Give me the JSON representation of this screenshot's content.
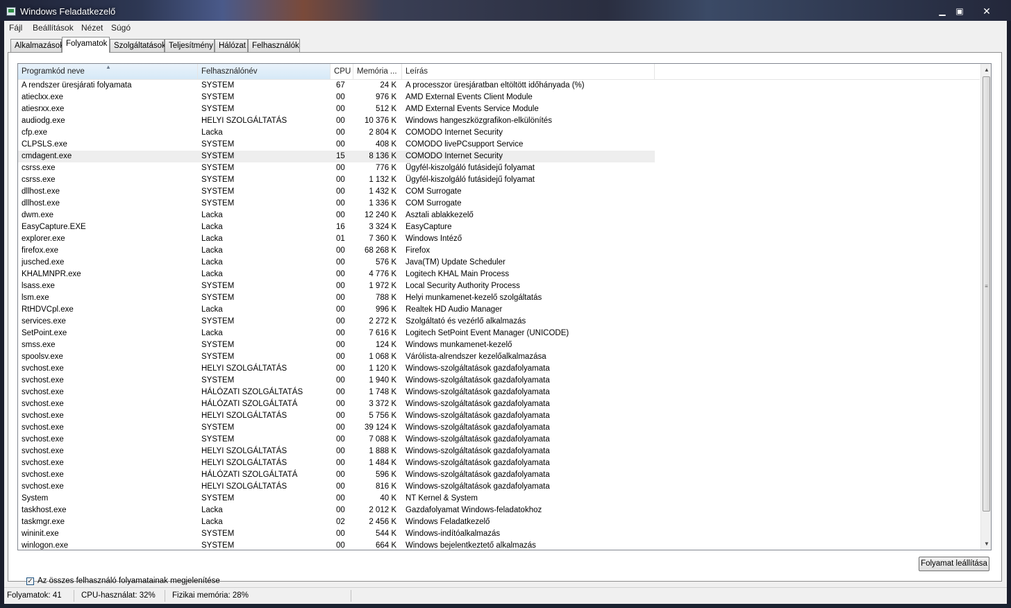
{
  "window": {
    "title": "Windows Feladatkezelő"
  },
  "menu": [
    "Fájl",
    "Beállítások",
    "Nézet",
    "Súgó"
  ],
  "tabs": [
    "Alkalmazások",
    "Folyamatok",
    "Szolgáltatások",
    "Teljesítmény",
    "Hálózat",
    "Felhasználók"
  ],
  "active_tab": "Folyamatok",
  "columns": [
    "Programkód neve",
    "Felhasználónév",
    "CPU",
    "Memória ...",
    "Leírás"
  ],
  "rows": [
    [
      "A rendszer üresjárati folyamata",
      "SYSTEM",
      "67",
      "24 K",
      "A processzor üresjáratban eltöltött időhányada (%)"
    ],
    [
      "atieclxx.exe",
      "SYSTEM",
      "00",
      "976 K",
      "AMD External Events Client Module"
    ],
    [
      "atiesrxx.exe",
      "SYSTEM",
      "00",
      "512 K",
      "AMD External Events Service Module"
    ],
    [
      "audiodg.exe",
      "HELYI SZOLGÁLTATÁS",
      "00",
      "10 376 K",
      "Windows hangeszközgrafikon-elkülönítés"
    ],
    [
      "cfp.exe",
      "Lacka",
      "00",
      "2 804 K",
      "COMODO Internet Security"
    ],
    [
      "CLPSLS.exe",
      "SYSTEM",
      "00",
      "408 K",
      "COMODO livePCsupport Service"
    ],
    [
      "cmdagent.exe",
      "SYSTEM",
      "15",
      "8 136 K",
      "COMODO Internet Security"
    ],
    [
      "csrss.exe",
      "SYSTEM",
      "00",
      "776 K",
      "Ügyfél-kiszolgáló futásidejű folyamat"
    ],
    [
      "csrss.exe",
      "SYSTEM",
      "00",
      "1 132 K",
      "Ügyfél-kiszolgáló futásidejű folyamat"
    ],
    [
      "dllhost.exe",
      "SYSTEM",
      "00",
      "1 432 K",
      "COM Surrogate"
    ],
    [
      "dllhost.exe",
      "SYSTEM",
      "00",
      "1 336 K",
      "COM Surrogate"
    ],
    [
      "dwm.exe",
      "Lacka",
      "00",
      "12 240 K",
      "Asztali ablakkezelő"
    ],
    [
      "EasyCapture.EXE",
      "Lacka",
      "16",
      "3 324 K",
      "EasyCapture"
    ],
    [
      "explorer.exe",
      "Lacka",
      "01",
      "7 360 K",
      "Windows Intéző"
    ],
    [
      "firefox.exe",
      "Lacka",
      "00",
      "68 268 K",
      "Firefox"
    ],
    [
      "jusched.exe",
      "Lacka",
      "00",
      "576 K",
      "Java(TM) Update Scheduler"
    ],
    [
      "KHALMNPR.exe",
      "Lacka",
      "00",
      "4 776 K",
      "Logitech KHAL Main Process"
    ],
    [
      "lsass.exe",
      "SYSTEM",
      "00",
      "1 972 K",
      "Local Security Authority Process"
    ],
    [
      "lsm.exe",
      "SYSTEM",
      "00",
      "788 K",
      "Helyi munkamenet-kezelő szolgáltatás"
    ],
    [
      "RtHDVCpl.exe",
      "Lacka",
      "00",
      "996 K",
      "Realtek HD Audio Manager"
    ],
    [
      "services.exe",
      "SYSTEM",
      "00",
      "2 272 K",
      "Szolgáltató és vezérlő alkalmazás"
    ],
    [
      "SetPoint.exe",
      "Lacka",
      "00",
      "7 616 K",
      "Logitech SetPoint Event Manager (UNICODE)"
    ],
    [
      "smss.exe",
      "SYSTEM",
      "00",
      "124 K",
      "Windows munkamenet-kezelő"
    ],
    [
      "spoolsv.exe",
      "SYSTEM",
      "00",
      "1 068 K",
      "Várólista-alrendszer kezelőalkalmazása"
    ],
    [
      "svchost.exe",
      "HELYI SZOLGÁLTATÁS",
      "00",
      "1 120 K",
      "Windows-szolgáltatások gazdafolyamata"
    ],
    [
      "svchost.exe",
      "SYSTEM",
      "00",
      "1 940 K",
      "Windows-szolgáltatások gazdafolyamata"
    ],
    [
      "svchost.exe",
      "HÁLÓZATI SZOLGÁLTATÁS",
      "00",
      "1 748 K",
      "Windows-szolgáltatások gazdafolyamata"
    ],
    [
      "svchost.exe",
      "HÁLÓZATI SZOLGÁLTATÁ",
      "00",
      "3 372 K",
      "Windows-szolgáltatások gazdafolyamata"
    ],
    [
      "svchost.exe",
      "HELYI SZOLGÁLTATÁS",
      "00",
      "5 756 K",
      "Windows-szolgáltatások gazdafolyamata"
    ],
    [
      "svchost.exe",
      "SYSTEM",
      "00",
      "39 124 K",
      "Windows-szolgáltatások gazdafolyamata"
    ],
    [
      "svchost.exe",
      "SYSTEM",
      "00",
      "7 088 K",
      "Windows-szolgáltatások gazdafolyamata"
    ],
    [
      "svchost.exe",
      "HELYI SZOLGÁLTATÁS",
      "00",
      "1 888 K",
      "Windows-szolgáltatások gazdafolyamata"
    ],
    [
      "svchost.exe",
      "HELYI SZOLGÁLTATÁS",
      "00",
      "1 484 K",
      "Windows-szolgáltatások gazdafolyamata"
    ],
    [
      "svchost.exe",
      "HÁLÓZATI SZOLGÁLTATÁ",
      "00",
      "596 K",
      "Windows-szolgáltatások gazdafolyamata"
    ],
    [
      "svchost.exe",
      "HELYI SZOLGÁLTATÁS",
      "00",
      "816 K",
      "Windows-szolgáltatások gazdafolyamata"
    ],
    [
      "System",
      "SYSTEM",
      "00",
      "40 K",
      "NT Kernel & System"
    ],
    [
      "taskhost.exe",
      "Lacka",
      "00",
      "2 012 K",
      "Gazdafolyamat Windows-feladatokhoz"
    ],
    [
      "taskmgr.exe",
      "Lacka",
      "02",
      "2 456 K",
      "Windows Feladatkezelő"
    ],
    [
      "wininit.exe",
      "SYSTEM",
      "00",
      "544 K",
      "Windows-indítóalkalmazás"
    ],
    [
      "winlogon.exe",
      "SYSTEM",
      "00",
      "664 K",
      "Windows bejelentkeztető alkalmazás"
    ]
  ],
  "highlighted_row": 6,
  "show_all_users": {
    "label": "Az összes felhasználó folyamatainak megjelenítése",
    "checked": true
  },
  "end_process_button": "Folyamat leállítása",
  "status": {
    "processes": "Folyamatok: 41",
    "cpu": "CPU-használat: 32%",
    "memory": "Fizikai memória: 28%"
  }
}
